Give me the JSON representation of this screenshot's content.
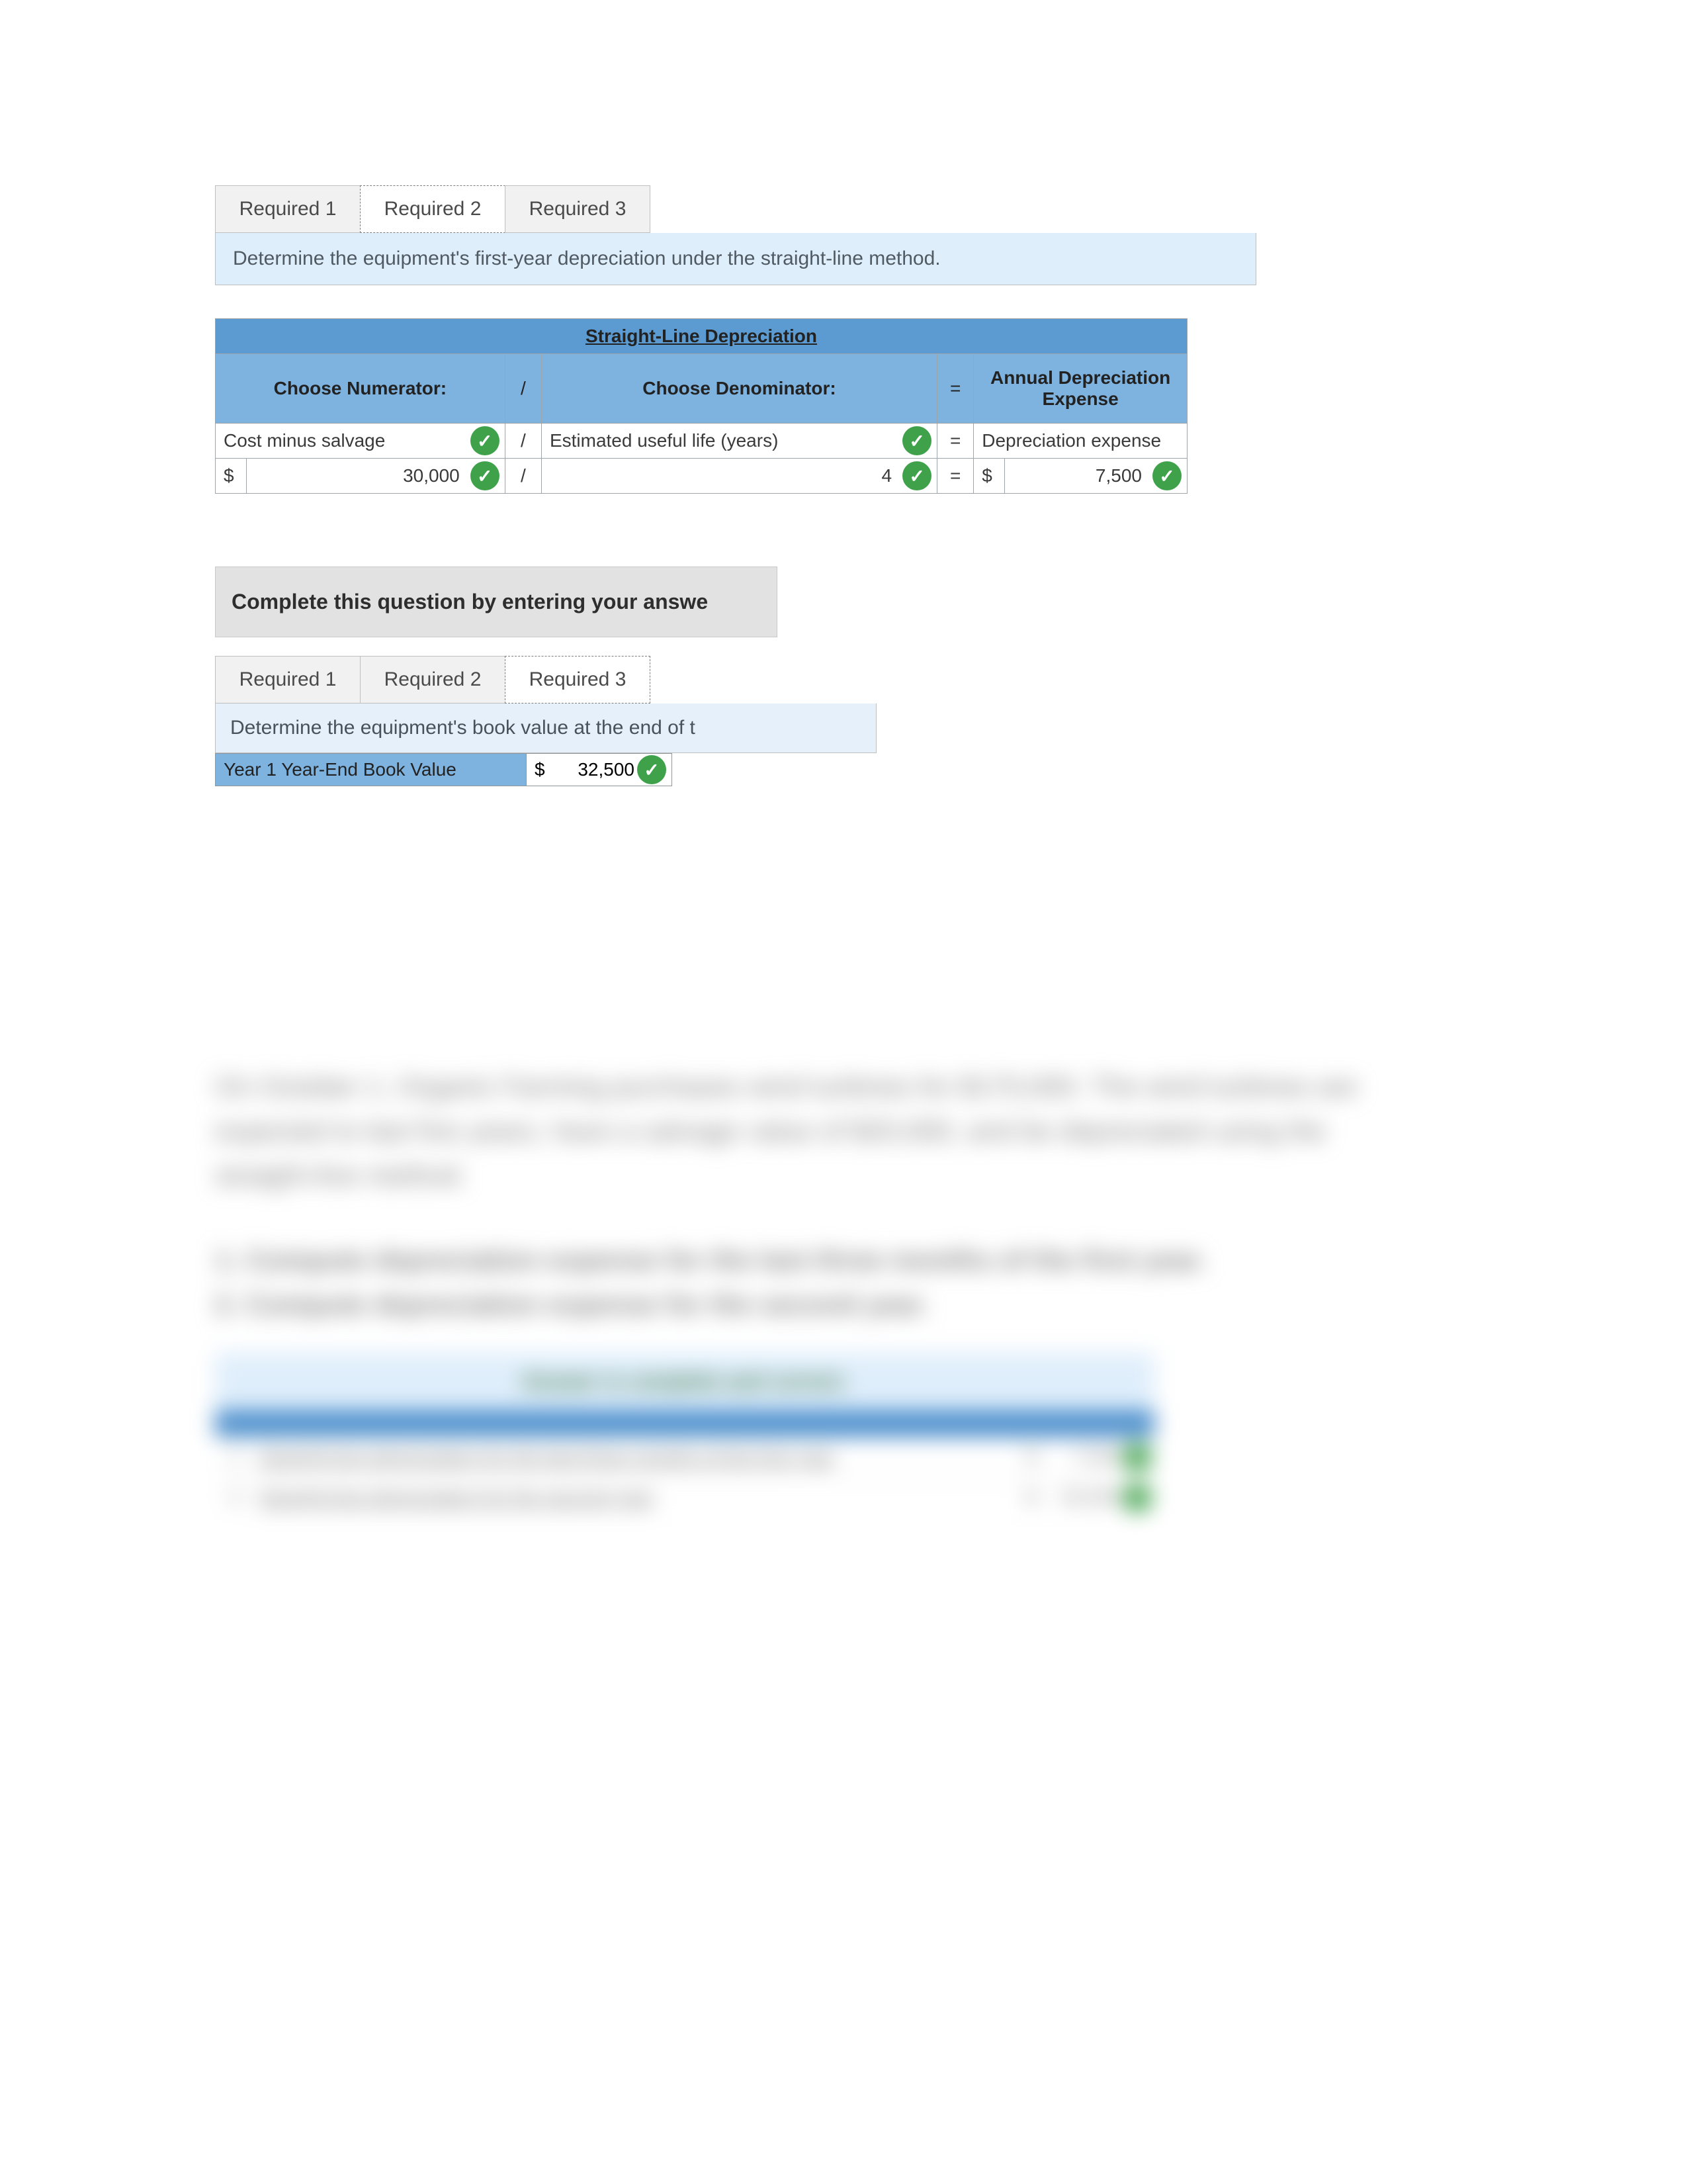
{
  "section1": {
    "tabs": [
      "Required 1",
      "Required 2",
      "Required 3"
    ],
    "activeTab": 1,
    "instruction": "Determine the equipment's first-year depreciation under the straight-line method.",
    "table": {
      "title": "Straight-Line Depreciation",
      "headers": {
        "numerator": "Choose Numerator:",
        "div": "/",
        "denominator": "Choose Denominator:",
        "eq": "=",
        "result": "Annual Depreciation Expense"
      },
      "row1": {
        "numerator": "Cost minus salvage",
        "div": "/",
        "denominator": "Estimated useful life (years)",
        "eq": "=",
        "result": "Depreciation expense"
      },
      "row2": {
        "dollar": "$",
        "numerator": "30,000",
        "div": "/",
        "denominator": "4",
        "eq": "=",
        "resultDollar": "$",
        "result": "7,500"
      }
    }
  },
  "section2": {
    "banner": "Complete this question by entering your answe",
    "tabs": [
      "Required 1",
      "Required 2",
      "Required 3"
    ],
    "activeTab": 2,
    "instruction": "Determine the equipment's book value at the end of t",
    "bookValue": {
      "label": "Year 1 Year-End Book Value",
      "dollar": "$",
      "value": "32,500"
    }
  },
  "blurred": {
    "p1": "On October 1, Organic Farming purchases wind turbines for $170,000. The wind turbines are expected to last five years, have a salvage value of $20,000, and be depreciated using the straight-line method.",
    "q1": "1. Compute depreciation expense for the last three months of the first year.",
    "q2": "2. Compute depreciation expense for the second year.",
    "boxBanner": "Answer is complete and correct.",
    "rows": [
      {
        "n": "1",
        "t": "Straight-line depreciation for the last three months of the first year",
        "d": "$",
        "v": "7,500"
      },
      {
        "n": "2",
        "t": "Straight-line depreciation for the second year",
        "d": "$",
        "v": "30,000"
      }
    ]
  }
}
